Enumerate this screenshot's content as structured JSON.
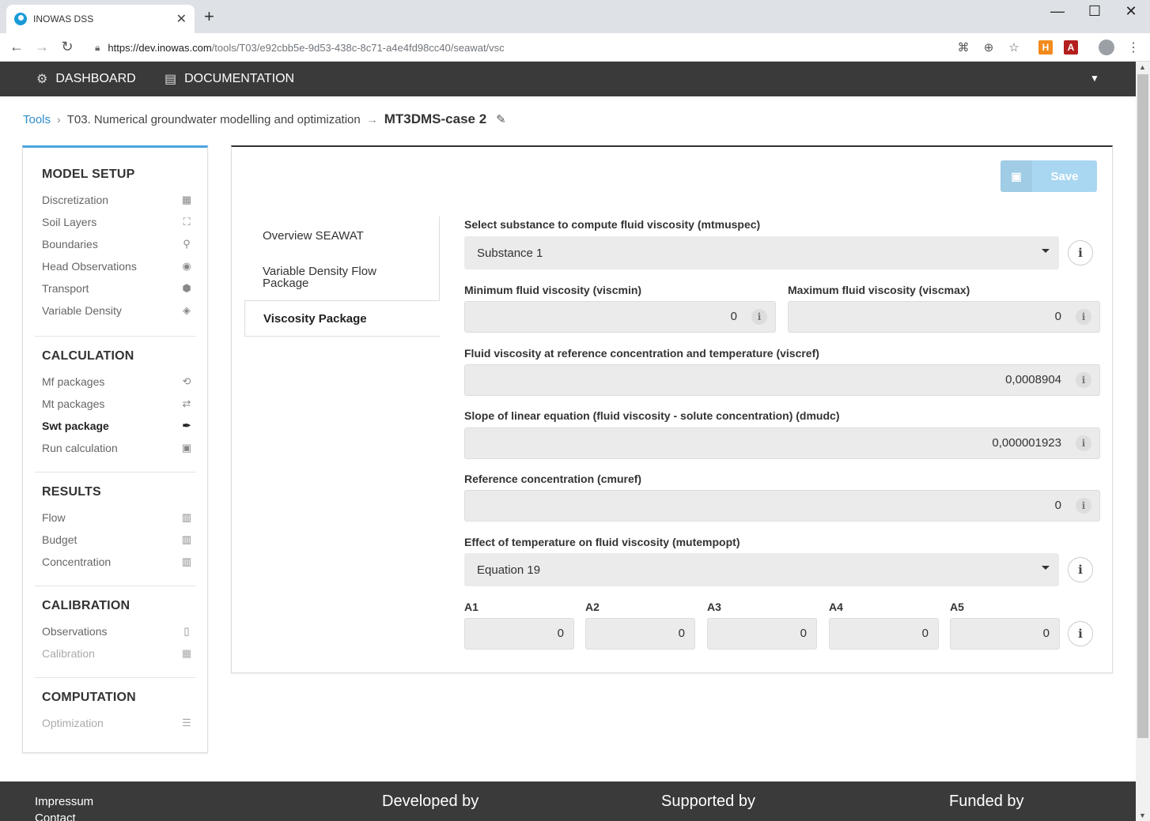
{
  "browser": {
    "tab_title": "INOWAS DSS",
    "tab_close": "✕",
    "new_tab": "+",
    "url_host": "https://dev.inowas.com",
    "url_path": "/tools/T03/e92cbb5e-9d53-438c-8c71-a4e4fd98cc40/seawat/vsc",
    "window_controls": [
      "—",
      "☐",
      "✕"
    ],
    "ext_h": "H",
    "ext_a": "A"
  },
  "nav": {
    "dashboard": "DASHBOARD",
    "documentation": "DOCUMENTATION"
  },
  "breadcrumb": {
    "tools": "Tools",
    "tool": "T03. Numerical groundwater modelling and optimization",
    "model": "MT3DMS-case 2"
  },
  "sidebar": {
    "model_setup": {
      "title": "MODEL SETUP",
      "items": [
        "Discretization",
        "Soil Layers",
        "Boundaries",
        "Head Observations",
        "Transport",
        "Variable Density"
      ]
    },
    "calculation": {
      "title": "CALCULATION",
      "items": [
        "Mf packages",
        "Mt packages",
        "Swt package",
        "Run calculation"
      ]
    },
    "results": {
      "title": "RESULTS",
      "items": [
        "Flow",
        "Budget",
        "Concentration"
      ]
    },
    "calibration": {
      "title": "CALIBRATION",
      "items": [
        "Observations",
        "Calibration"
      ]
    },
    "computation": {
      "title": "COMPUTATION",
      "items": [
        "Optimization"
      ]
    }
  },
  "panel": {
    "save_label": "Save",
    "tabs": [
      "Overview SEAWAT",
      "Variable Density Flow Package",
      "Viscosity Package"
    ],
    "fields": {
      "mtmuspec_label": "Select substance to compute fluid viscosity (mtmuspec)",
      "mtmuspec_value": "Substance 1",
      "viscmin_label": "Minimum fluid viscosity (viscmin)",
      "viscmin_value": "0",
      "viscmax_label": "Maximum fluid viscosity (viscmax)",
      "viscmax_value": "0",
      "viscref_label": "Fluid viscosity at reference concentration and temperature (viscref)",
      "viscref_value": "0,0008904",
      "dmudc_label": "Slope of linear equation (fluid viscosity - solute concentration) (dmudc)",
      "dmudc_value": "0,000001923",
      "cmuref_label": "Reference concentration (cmuref)",
      "cmuref_value": "0",
      "mutempopt_label": "Effect of temperature on fluid viscosity (mutempopt)",
      "mutempopt_value": "Equation 19",
      "a_labels": [
        "A1",
        "A2",
        "A3",
        "A4",
        "A5"
      ],
      "a_values": [
        "0",
        "0",
        "0",
        "0",
        "0"
      ]
    }
  },
  "footer": {
    "impressum": "Impressum",
    "contact": "Contact",
    "developed_by": "Developed by",
    "supported_by": "Supported by",
    "funded_by": "Funded by"
  },
  "colors": {
    "accent": "#2e8bc9",
    "nav_bg": "#3a3a3a",
    "save_bg": "#a9d7f2"
  }
}
